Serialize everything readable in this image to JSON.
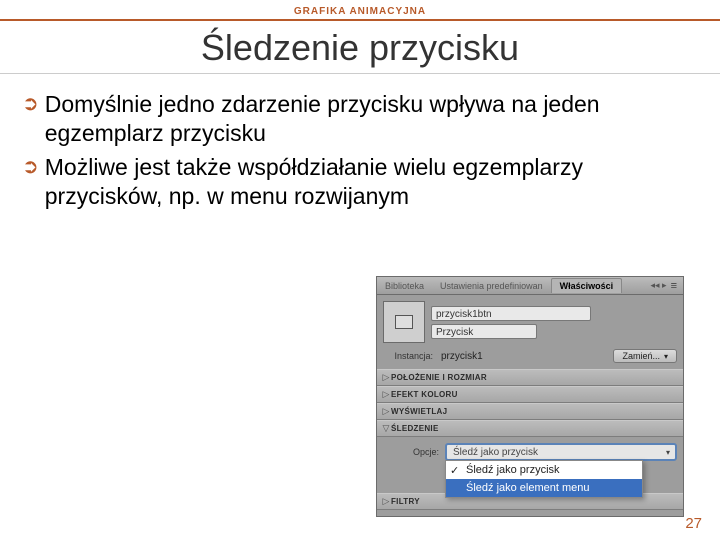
{
  "header": {
    "kicker": "GRAFIKA ANIMACYJNA"
  },
  "title": "Śledzenie przycisku",
  "bullets": [
    "Domyślnie jedno zdarzenie przycisku wpływa na jeden egzemplarz przycisku",
    "Możliwe jest także współdziałanie wielu egzemplarzy przycisków, np. w menu rozwijanym"
  ],
  "panel": {
    "tabs": [
      "Biblioteka",
      "Ustawienia predefiniowan",
      "Właściwości"
    ],
    "chev": "◂◂ ▸",
    "menu_icon": "≡",
    "instance_name": "przycisk1btn",
    "type_label": "Przycisk",
    "instance_label": "Instancja:",
    "instance_value": "przycisk1",
    "swap_label": "Zamień...",
    "sections": {
      "pos": "POŁOŻENIE I ROZMIAR",
      "color": "EFEKT KOLORU",
      "display": "WYŚWIETLAJ",
      "track": "ŚLEDZENIE",
      "filters": "FILTRY"
    },
    "options_label": "Opcje:",
    "dd_selected": "Śledź jako przycisk",
    "dd_items": [
      "Śledź jako przycisk",
      "Śledź jako element menu"
    ]
  },
  "page_number": "27"
}
